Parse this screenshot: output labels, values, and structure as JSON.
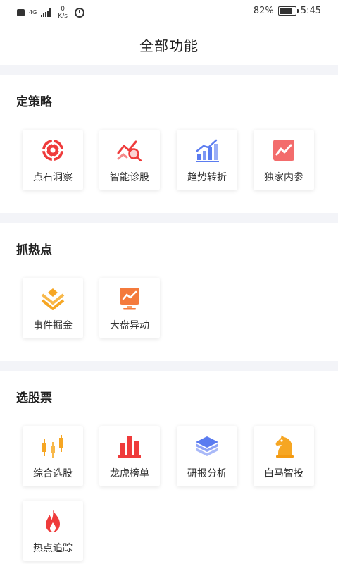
{
  "status_bar": {
    "network": "4G",
    "speed_value": "0",
    "speed_unit": "K/s",
    "battery_percent": "82%",
    "battery_level": 0.82,
    "time": "5:45"
  },
  "header": {
    "title": "全部功能"
  },
  "sections": [
    {
      "title": "定策略",
      "items": [
        {
          "label": "点石洞察",
          "icon": "target-icon"
        },
        {
          "label": "智能诊股",
          "icon": "trend-search-icon"
        },
        {
          "label": "趋势转折",
          "icon": "bar-trend-icon"
        },
        {
          "label": "独家内参",
          "icon": "line-chart-card-icon"
        }
      ]
    },
    {
      "title": "抓热点",
      "items": [
        {
          "label": "事件掘金",
          "icon": "layers-diamond-icon"
        },
        {
          "label": "大盘异动",
          "icon": "monitor-chart-icon"
        }
      ]
    },
    {
      "title": "选股票",
      "items": [
        {
          "label": "综合选股",
          "icon": "candlestick-icon"
        },
        {
          "label": "龙虎榜单",
          "icon": "ranking-bars-icon"
        },
        {
          "label": "研报分析",
          "icon": "stack-layers-icon"
        },
        {
          "label": "白马智投",
          "icon": "horse-knight-icon"
        },
        {
          "label": "热点追踪",
          "icon": "flame-icon"
        }
      ]
    }
  ],
  "colors": {
    "red": "#ef3b3b",
    "orange": "#f6a623",
    "blue": "#5b7cf0",
    "separator": "#f3f4f8"
  }
}
